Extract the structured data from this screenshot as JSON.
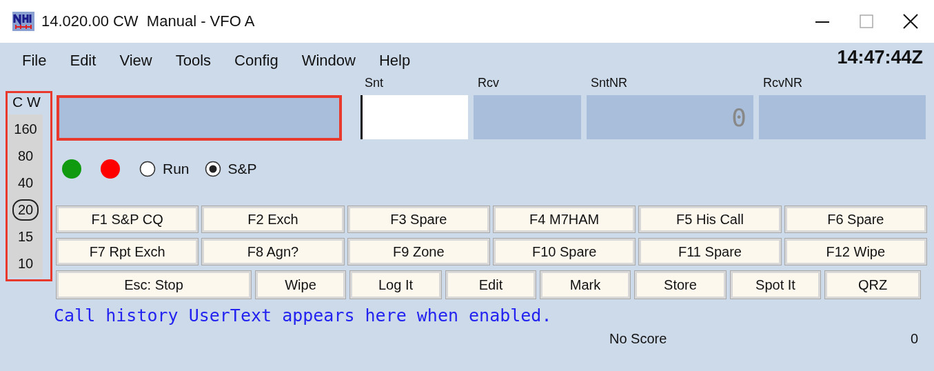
{
  "window": {
    "title": "14.020.00 CW  Manual - VFO A"
  },
  "menu": [
    "File",
    "Edit",
    "View",
    "Tools",
    "Config",
    "Window",
    "Help"
  ],
  "clock": "14:47:44Z",
  "band_panel": {
    "mode": "C W",
    "highlighted": true,
    "bands": [
      {
        "label": "160",
        "selected": false
      },
      {
        "label": "80",
        "selected": false
      },
      {
        "label": "40",
        "selected": false
      },
      {
        "label": "20",
        "selected": true
      },
      {
        "label": "15",
        "selected": false
      },
      {
        "label": "10",
        "selected": false
      }
    ]
  },
  "call_field": {
    "highlighted": true
  },
  "fields": [
    {
      "label": "Snt",
      "active": true
    },
    {
      "label": "Rcv",
      "active": false
    },
    {
      "label": "SntNR",
      "active": false,
      "value": "0"
    },
    {
      "label": "RcvNR",
      "active": false
    }
  ],
  "indicators": [
    {
      "color": "#109a10"
    },
    {
      "color": "#ff0000"
    }
  ],
  "mode_radios": [
    {
      "label": "Run",
      "selected": false
    },
    {
      "label": "S&P",
      "selected": true
    }
  ],
  "function_keys": [
    [
      "F1 S&P CQ",
      "F2 Exch",
      "F3 Spare",
      "F4 M7HAM",
      "F5 His Call",
      "F6 Spare"
    ],
    [
      "F7 Rpt Exch",
      "F8 Agn?",
      "F9 Zone",
      "F10 Spare",
      "F11 Spare",
      "F12 Wipe"
    ]
  ],
  "action_buttons": [
    "Esc: Stop",
    "Wipe",
    "Log It",
    "Edit",
    "Mark",
    "Store",
    "Spot It",
    "QRZ"
  ],
  "user_text": "Call history UserText appears here when enabled.",
  "status": {
    "score": "No Score",
    "count": "0"
  }
}
